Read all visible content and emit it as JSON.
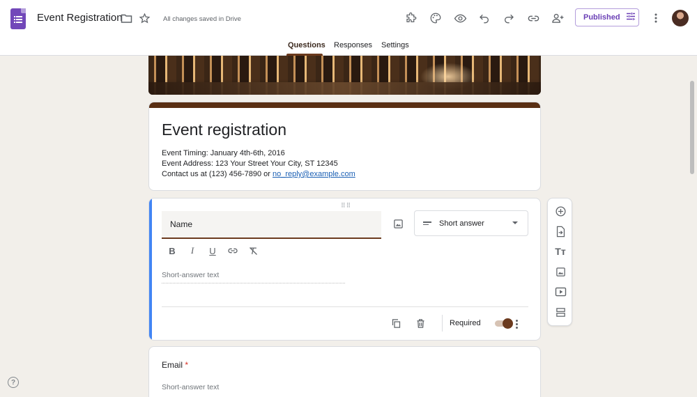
{
  "header": {
    "doc_title": "Event Registration",
    "save_status": "All changes saved in Drive",
    "publish_label": "Published"
  },
  "tabs": [
    {
      "label": "Questions",
      "active": true
    },
    {
      "label": "Responses",
      "active": false
    },
    {
      "label": "Settings",
      "active": false
    }
  ],
  "form": {
    "title": "Event registration",
    "description_lines": [
      "Event Timing: January 4th-6th, 2016",
      "Event Address: 123 Your Street Your City, ST 12345"
    ],
    "contact_prefix": "Contact us at (123) 456-7890 or ",
    "contact_email": "no_reply@example.com"
  },
  "question": {
    "title": "Name",
    "type": "Short answer",
    "answer_placeholder": "Short-answer text",
    "required_label": "Required",
    "required": true
  },
  "email_question": {
    "title": "Email",
    "required_mark": "*",
    "answer_placeholder": "Short-answer text"
  },
  "help": "?",
  "colors": {
    "accent": "#6b3a1e",
    "question_focus": "#4285f4",
    "brand_purple": "#7248b9",
    "published_purple": "#6a3fb5"
  }
}
